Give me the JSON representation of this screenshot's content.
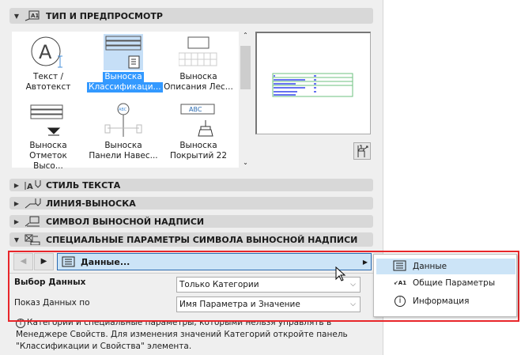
{
  "sections": {
    "type_preview": "ТИП И ПРЕДПРОСМОТР",
    "text_style": "СТИЛЬ ТЕКСТА",
    "leader_line": "ЛИНИЯ-ВЫНОСКА",
    "label_symbol": "СИМВОЛ ВЫНОСНОЙ НАДПИСИ",
    "special_params": "СПЕЦИАЛЬНЫЕ ПАРАМЕТРЫ СИМВОЛА ВЫНОСНОЙ НАДПИСИ"
  },
  "types": [
    {
      "l1": "Текст /",
      "l2": "Автотекст",
      "selected": false
    },
    {
      "l1": "Выноска",
      "l2": "Классификаци...",
      "selected": true
    },
    {
      "l1": "Выноска",
      "l2": "Описания Лес...",
      "selected": false
    },
    {
      "l1": "Выноска",
      "l2": "Отметок Высо...",
      "selected": false
    },
    {
      "l1": "Выноска",
      "l2": "Панели Навес...",
      "selected": false
    },
    {
      "l1": "Выноска",
      "l2": "Покрытий 22",
      "selected": false
    }
  ],
  "thumb_text": {
    "abc": "ABC"
  },
  "nav": {
    "page": "Данные..."
  },
  "fields": [
    {
      "label": "Выбор Данных",
      "value": "Только Категории"
    },
    {
      "label": "Показ Данных по",
      "value": "Имя Параметра и Значение"
    }
  ],
  "menu": [
    {
      "label": "Данные",
      "icon": "list-icon",
      "active": true
    },
    {
      "label": "Общие Параметры",
      "icon": "leader-a1-icon",
      "active": false
    },
    {
      "label": "Информация",
      "icon": "info-icon",
      "active": false
    }
  ],
  "info_text": "Категории и специальные параметры, которыми нельзя управлять в Менеджере Свойств. Для изменения значений Категорий откройте панель \"Классификации и Свойства\" элемента.",
  "colors": {
    "highlight": "#cce4f7",
    "selection": "#3399ff",
    "red_frame": "#e8262a"
  }
}
